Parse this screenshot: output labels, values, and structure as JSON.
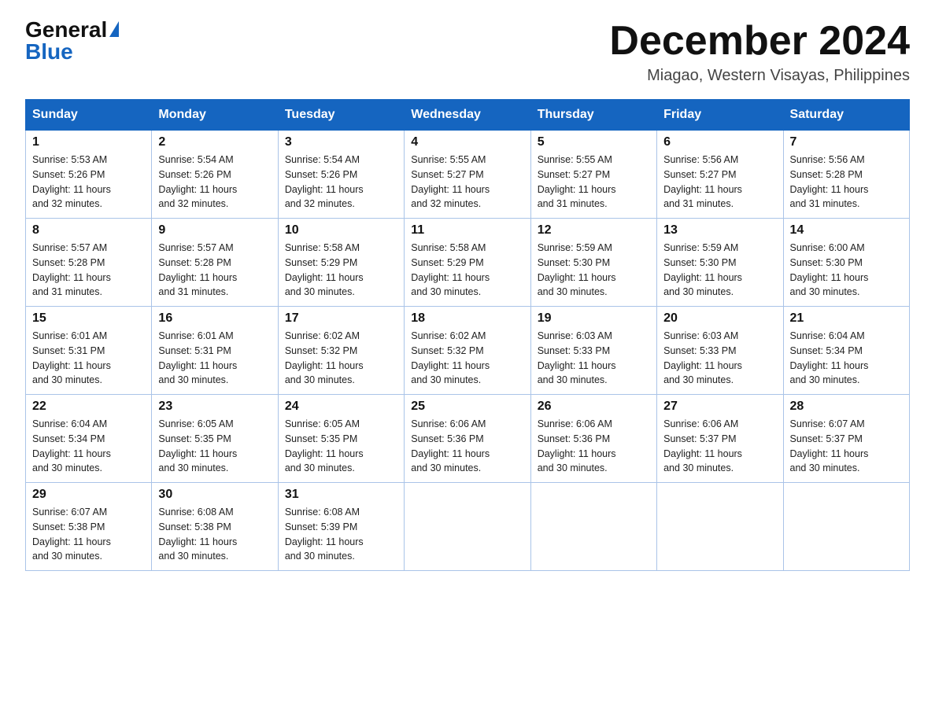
{
  "logo": {
    "line1": "General",
    "line2": "Blue"
  },
  "header": {
    "month_title": "December 2024",
    "location": "Miagao, Western Visayas, Philippines"
  },
  "days_of_week": [
    "Sunday",
    "Monday",
    "Tuesday",
    "Wednesday",
    "Thursday",
    "Friday",
    "Saturday"
  ],
  "weeks": [
    [
      {
        "day": "1",
        "sunrise": "5:53 AM",
        "sunset": "5:26 PM",
        "daylight": "11 hours and 32 minutes."
      },
      {
        "day": "2",
        "sunrise": "5:54 AM",
        "sunset": "5:26 PM",
        "daylight": "11 hours and 32 minutes."
      },
      {
        "day": "3",
        "sunrise": "5:54 AM",
        "sunset": "5:26 PM",
        "daylight": "11 hours and 32 minutes."
      },
      {
        "day": "4",
        "sunrise": "5:55 AM",
        "sunset": "5:27 PM",
        "daylight": "11 hours and 32 minutes."
      },
      {
        "day": "5",
        "sunrise": "5:55 AM",
        "sunset": "5:27 PM",
        "daylight": "11 hours and 31 minutes."
      },
      {
        "day": "6",
        "sunrise": "5:56 AM",
        "sunset": "5:27 PM",
        "daylight": "11 hours and 31 minutes."
      },
      {
        "day": "7",
        "sunrise": "5:56 AM",
        "sunset": "5:28 PM",
        "daylight": "11 hours and 31 minutes."
      }
    ],
    [
      {
        "day": "8",
        "sunrise": "5:57 AM",
        "sunset": "5:28 PM",
        "daylight": "11 hours and 31 minutes."
      },
      {
        "day": "9",
        "sunrise": "5:57 AM",
        "sunset": "5:28 PM",
        "daylight": "11 hours and 31 minutes."
      },
      {
        "day": "10",
        "sunrise": "5:58 AM",
        "sunset": "5:29 PM",
        "daylight": "11 hours and 30 minutes."
      },
      {
        "day": "11",
        "sunrise": "5:58 AM",
        "sunset": "5:29 PM",
        "daylight": "11 hours and 30 minutes."
      },
      {
        "day": "12",
        "sunrise": "5:59 AM",
        "sunset": "5:30 PM",
        "daylight": "11 hours and 30 minutes."
      },
      {
        "day": "13",
        "sunrise": "5:59 AM",
        "sunset": "5:30 PM",
        "daylight": "11 hours and 30 minutes."
      },
      {
        "day": "14",
        "sunrise": "6:00 AM",
        "sunset": "5:30 PM",
        "daylight": "11 hours and 30 minutes."
      }
    ],
    [
      {
        "day": "15",
        "sunrise": "6:01 AM",
        "sunset": "5:31 PM",
        "daylight": "11 hours and 30 minutes."
      },
      {
        "day": "16",
        "sunrise": "6:01 AM",
        "sunset": "5:31 PM",
        "daylight": "11 hours and 30 minutes."
      },
      {
        "day": "17",
        "sunrise": "6:02 AM",
        "sunset": "5:32 PM",
        "daylight": "11 hours and 30 minutes."
      },
      {
        "day": "18",
        "sunrise": "6:02 AM",
        "sunset": "5:32 PM",
        "daylight": "11 hours and 30 minutes."
      },
      {
        "day": "19",
        "sunrise": "6:03 AM",
        "sunset": "5:33 PM",
        "daylight": "11 hours and 30 minutes."
      },
      {
        "day": "20",
        "sunrise": "6:03 AM",
        "sunset": "5:33 PM",
        "daylight": "11 hours and 30 minutes."
      },
      {
        "day": "21",
        "sunrise": "6:04 AM",
        "sunset": "5:34 PM",
        "daylight": "11 hours and 30 minutes."
      }
    ],
    [
      {
        "day": "22",
        "sunrise": "6:04 AM",
        "sunset": "5:34 PM",
        "daylight": "11 hours and 30 minutes."
      },
      {
        "day": "23",
        "sunrise": "6:05 AM",
        "sunset": "5:35 PM",
        "daylight": "11 hours and 30 minutes."
      },
      {
        "day": "24",
        "sunrise": "6:05 AM",
        "sunset": "5:35 PM",
        "daylight": "11 hours and 30 minutes."
      },
      {
        "day": "25",
        "sunrise": "6:06 AM",
        "sunset": "5:36 PM",
        "daylight": "11 hours and 30 minutes."
      },
      {
        "day": "26",
        "sunrise": "6:06 AM",
        "sunset": "5:36 PM",
        "daylight": "11 hours and 30 minutes."
      },
      {
        "day": "27",
        "sunrise": "6:06 AM",
        "sunset": "5:37 PM",
        "daylight": "11 hours and 30 minutes."
      },
      {
        "day": "28",
        "sunrise": "6:07 AM",
        "sunset": "5:37 PM",
        "daylight": "11 hours and 30 minutes."
      }
    ],
    [
      {
        "day": "29",
        "sunrise": "6:07 AM",
        "sunset": "5:38 PM",
        "daylight": "11 hours and 30 minutes."
      },
      {
        "day": "30",
        "sunrise": "6:08 AM",
        "sunset": "5:38 PM",
        "daylight": "11 hours and 30 minutes."
      },
      {
        "day": "31",
        "sunrise": "6:08 AM",
        "sunset": "5:39 PM",
        "daylight": "11 hours and 30 minutes."
      },
      null,
      null,
      null,
      null
    ]
  ],
  "labels": {
    "sunrise": "Sunrise:",
    "sunset": "Sunset:",
    "daylight": "Daylight:"
  }
}
